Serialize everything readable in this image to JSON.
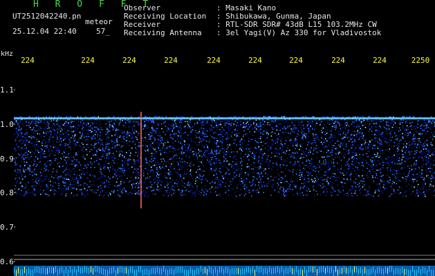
{
  "header": {
    "title": "H R O F F T",
    "filename": "UT2512042240.pn",
    "meteor_label": "meteor",
    "datetime": "25.12.04 22:40",
    "count": "57_"
  },
  "station": [
    {
      "label": "Observer",
      "value": ": Masaki Kano"
    },
    {
      "label": "Receiving Location",
      "value": ": Shibukawa, Gunma, Japan"
    },
    {
      "label": "Receiver",
      "value": ": RTL-SDR SDR# 43dB L15 103.2MHz CW"
    },
    {
      "label": "Receiving Antenna",
      "value": ": 3el Yagi(V) Az 330 for Vladivostok"
    }
  ],
  "x_axis": {
    "ticks": [
      "224",
      "224",
      "224",
      "224",
      "224",
      "224",
      "224",
      "224",
      "224",
      "2250"
    ]
  },
  "y_axis": {
    "unit": "kHz",
    "ticks": [
      "1.1",
      "1.0",
      "0.9",
      "0.8",
      "0.7",
      "0.6"
    ]
  },
  "colors": {
    "header_title": "#4cd94c",
    "labels": "#e8e8e8",
    "ticks": "#ffff33",
    "signal_low": "#1020a0",
    "signal_mid": "#2e7cff",
    "signal_high": "#9ef0ff",
    "meteor_trace": "#ff6060"
  }
}
